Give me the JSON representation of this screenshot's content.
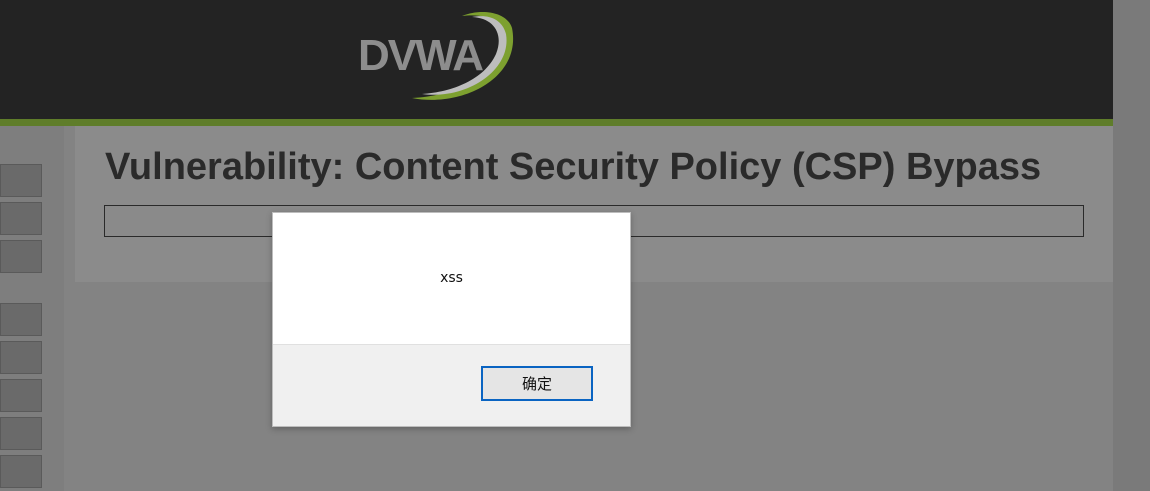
{
  "header": {
    "logo_text": "DVWA",
    "colors": {
      "background": "#232323",
      "accent_bar": "#5f7d2a"
    }
  },
  "sidebar": {
    "items": [
      {
        "label": ""
      },
      {
        "label": ""
      },
      {
        "label": ""
      },
      {
        "label": ""
      },
      {
        "label": ""
      },
      {
        "label": ""
      },
      {
        "label": ""
      },
      {
        "label": ""
      }
    ]
  },
  "main": {
    "title": "Vulnerability: Content Security Policy (CSP) Bypass"
  },
  "alert": {
    "message": "xss",
    "ok_label": "确定"
  }
}
